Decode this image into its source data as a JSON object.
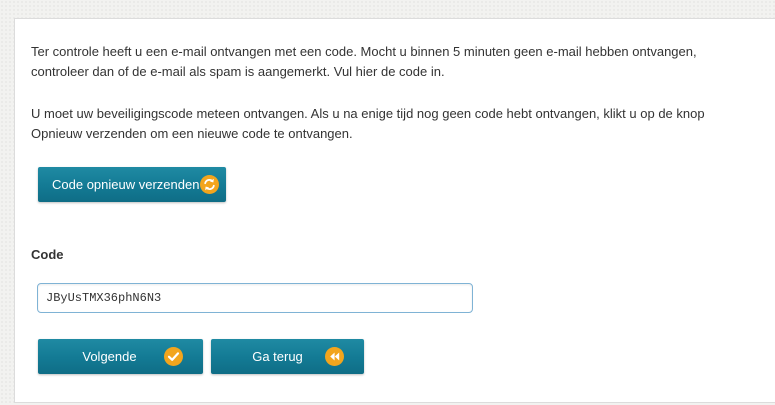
{
  "instructions": {
    "paragraph1": "Ter controle heeft u een e-mail ontvangen met een code. Mocht u binnen 5 minuten geen e-mail hebben ontvangen, controleer dan of de e-mail als spam is aangemerkt. Vul hier de code in.",
    "paragraph2": "U moet uw beveiligingscode meteen ontvangen. Als u na enige tijd nog geen code hebt ontvangen, klikt u op de knop Opnieuw verzenden om een nieuwe code te ontvangen."
  },
  "resend_button": {
    "label": "Code opnieuw verzenden",
    "icon": "refresh-icon"
  },
  "code_field": {
    "label": "Code",
    "value": "JByUsTMX36phN6N3"
  },
  "actions": {
    "next_label": "Volgende",
    "next_icon": "checkmark-icon",
    "back_label": "Ga terug",
    "back_icon": "rewind-icon"
  },
  "colors": {
    "button": "#137a94",
    "icon_accent": "#f2a51d",
    "input_border": "#7fb3d5"
  }
}
